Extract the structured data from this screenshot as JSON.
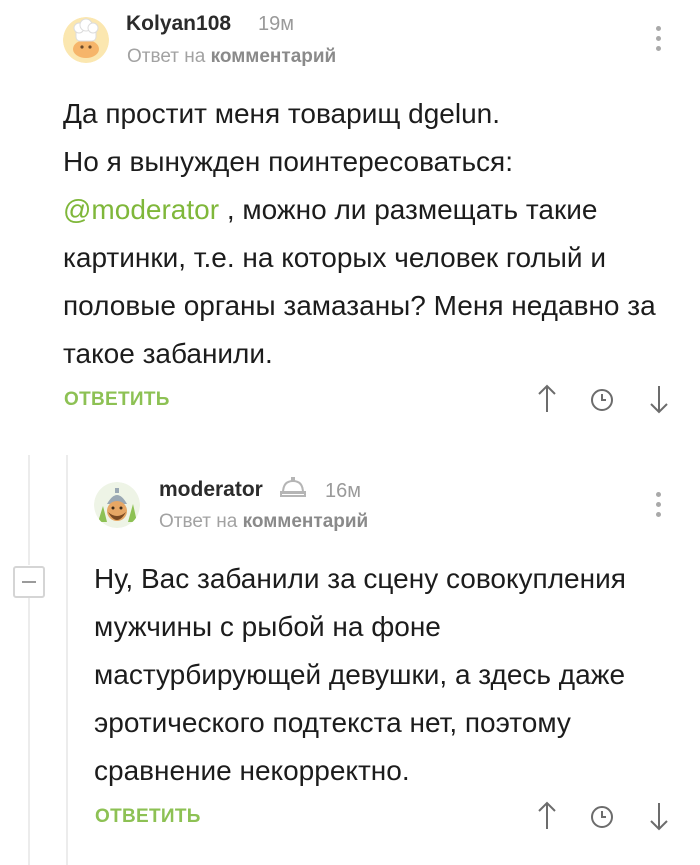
{
  "comments": [
    {
      "author": "Kolyan108",
      "time": "19м",
      "reply_prefix": "Ответ на",
      "reply_target": "комментарий",
      "text_before_mention": "Да простит меня товарищ dgelun.\nНо я вынужден поинтересоваться:",
      "mention": "@moderator",
      "text_after_mention": " , можно ли размещать такие картинки, т.е. на которых человек голый и половые органы замазаны? Меня недавно за такое забанили.",
      "reply_label": "ОТВЕТИТЬ",
      "icons": [
        "arrow-up-icon",
        "clock-icon",
        "arrow-down-icon"
      ]
    },
    {
      "author": "moderator",
      "time": "16м",
      "reply_prefix": "Ответ на",
      "reply_target": "комментарий",
      "text": "Ну, Вас забанили за сцену совокупления мужчины с рыбой на фоне мастурбирующей девушки, а здесь даже эротического подтекста нет, поэтому сравнение некорректно.",
      "reply_label": "ОТВЕТИТЬ",
      "icons": [
        "moderator-hat-icon",
        "arrow-up-icon",
        "clock-icon",
        "arrow-down-icon"
      ]
    }
  ],
  "colors": {
    "accent": "#8dc154",
    "mention": "#7fb73a",
    "muted": "#9a9a9a"
  }
}
